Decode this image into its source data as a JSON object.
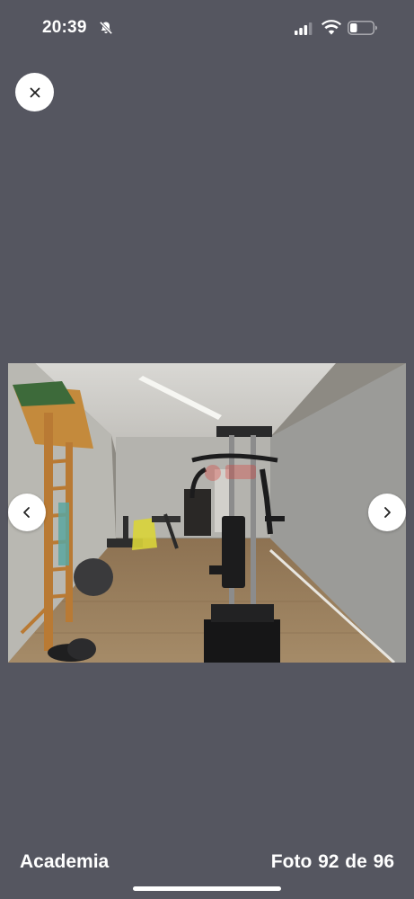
{
  "status_bar": {
    "time": "20:39",
    "icons": [
      "bell-slash-icon",
      "cellular-signal-icon",
      "wifi-icon",
      "battery-icon"
    ]
  },
  "viewer": {
    "close_icon": "close-icon",
    "prev_icon": "chevron-left-icon",
    "next_icon": "chevron-right-icon",
    "photo_alt": "Academia",
    "caption": "Academia",
    "counter": "Foto 92 de 96"
  },
  "colors": {
    "background": "#555660",
    "button": "#ffffff",
    "text": "#ffffff"
  }
}
